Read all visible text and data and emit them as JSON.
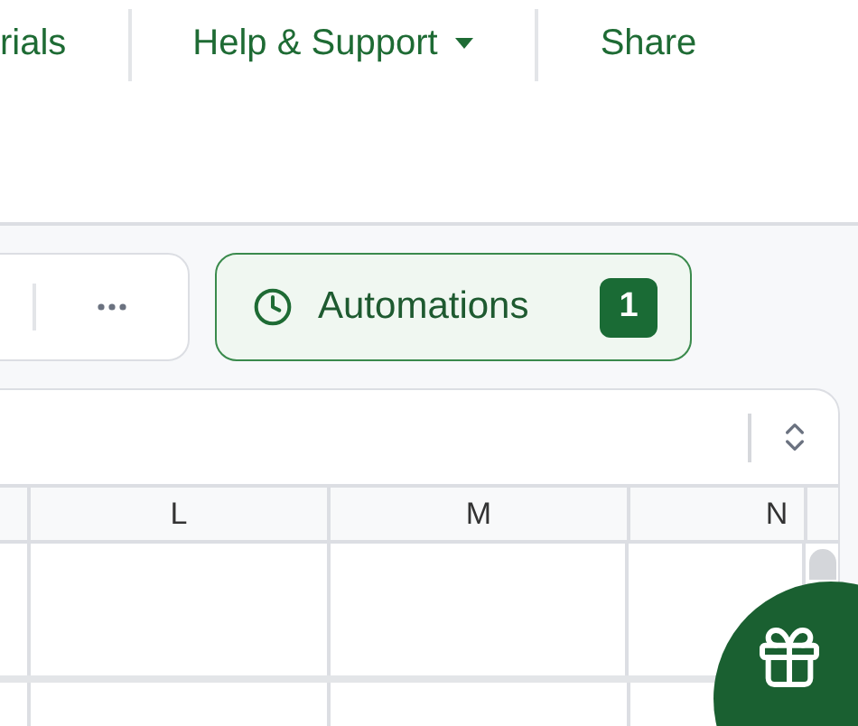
{
  "nav": [
    {
      "label": "rials",
      "kind": "link"
    },
    {
      "label": "Help & Support",
      "kind": "dropdown"
    },
    {
      "label": "Share",
      "kind": "link"
    }
  ],
  "toolbar": {
    "automations": {
      "label": "Automations",
      "count": "1"
    }
  },
  "grid": {
    "columns": [
      "L",
      "M",
      "N"
    ]
  }
}
